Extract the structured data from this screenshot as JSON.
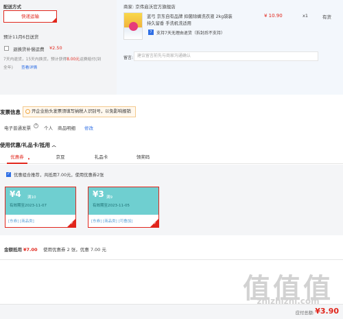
{
  "delivery": {
    "title": "配送方式",
    "method": "快递运输",
    "est_date": "预计11月6日送货",
    "insurance_label": "退换货补偿运费",
    "insurance_price": "¥2.50",
    "insurance_desc_1": "7天内退货，15天内换货，预计获得",
    "insurance_desc_highlight": "8.00元",
    "insurance_desc_2": "运费赔付(到",
    "insurance_desc_3": "全年)",
    "insurance_detail": "查看详情"
  },
  "seller": {
    "label": "商家:",
    "name": "京伟启沃官方旗舰店",
    "product_title_1": "蓝弓 京东自有品牌 抑菌除螨洗衣液 2kg袋装",
    "product_title_2": "持久留香 手洗机洗适用",
    "price": "¥ 10.90",
    "qty": "x1",
    "stock": "有货",
    "return_policy": "支持7天无理由退货（拆封后不支持）",
    "note_label": "留言:",
    "note_placeholder": "建议留言前先与商家沟通确认"
  },
  "invoice": {
    "title": "发票信息",
    "tip": "开企业抬头发票须填写纳税人识别号，以免影响报销",
    "type": "电子普通发票",
    "person": "个人",
    "detail": "商品明细",
    "edit": "修改"
  },
  "coupons": {
    "title": "使用优惠/礼品卡/抵用",
    "tabs": [
      {
        "label": "优惠券"
      },
      {
        "label": "京豆"
      },
      {
        "label": "礼品卡"
      },
      {
        "label": "领奖码"
      }
    ],
    "combo_text": "优惠组合推荐，共抵用7.00元，使用优惠券2张",
    "items": [
      {
        "amount": "¥4",
        "cond": "满10",
        "date": "有效期至2023-11-07",
        "tags": "[东券]  [商品类]"
      },
      {
        "amount": "¥3",
        "cond": "满9",
        "date": "有效期至2023-11-05",
        "tags": "[东券]  [商品类]  [可叠加]"
      }
    ]
  },
  "summary": {
    "label": "金额抵用",
    "amount": "¥7.00",
    "desc": "使用优惠券 2 张，优惠 7.00 元"
  },
  "footer": {
    "label": "应付总额:",
    "total": "¥3.90"
  },
  "watermark": {
    "big": "值值值",
    "small": "zhizhizhi.com"
  }
}
